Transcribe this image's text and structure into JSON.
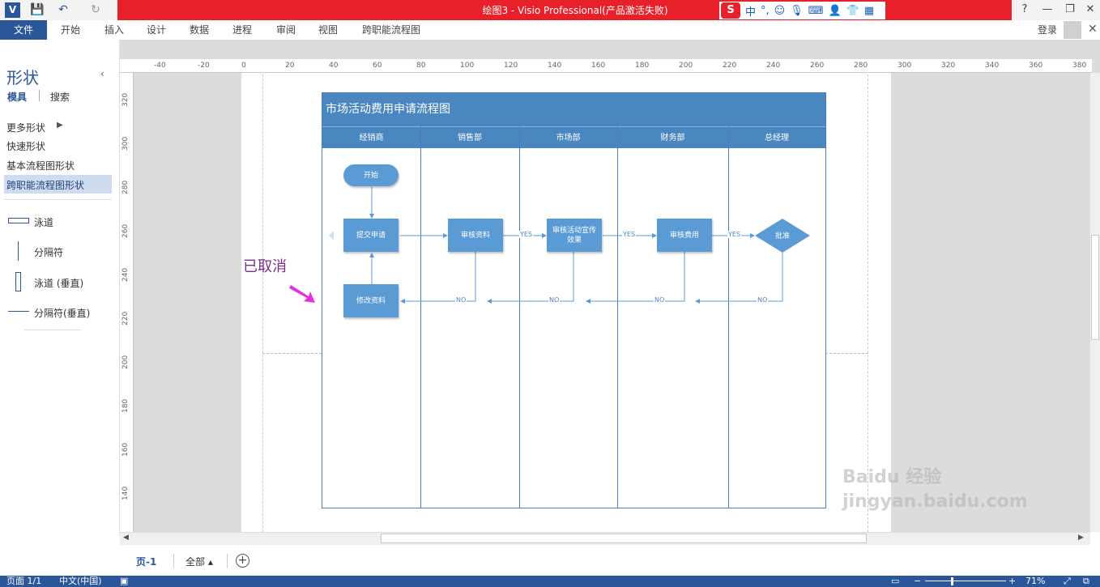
{
  "window": {
    "title": "绘图3 - Visio Professional(产品激活失败)",
    "help": "?",
    "minimize": "—",
    "restore": "❐",
    "close": "✕"
  },
  "ime": {
    "logo": "S",
    "mode": "中",
    "punct": "°,"
  },
  "ribbon": {
    "file": "文件",
    "tabs": [
      "开始",
      "插入",
      "设计",
      "数据",
      "进程",
      "审阅",
      "视图",
      "跨职能流程图"
    ],
    "login": "登录"
  },
  "shapes_panel": {
    "title": "形状",
    "tab_stencils": "模具",
    "tab_search": "搜索",
    "links": [
      "更多形状",
      "快速形状",
      "基本流程图形状",
      "跨职能流程图形状"
    ],
    "items": [
      "泳道",
      "分隔符",
      "泳道 (垂直)",
      "分隔符(垂直)"
    ]
  },
  "ruler": {
    "top": [
      "-40",
      "-20",
      "0",
      "20",
      "40",
      "60",
      "80",
      "100",
      "120",
      "140",
      "160",
      "180",
      "200",
      "220",
      "240",
      "260",
      "280",
      "300",
      "320",
      "340",
      "360",
      "380"
    ],
    "left": [
      "320",
      "300",
      "280",
      "260",
      "240",
      "220",
      "200",
      "180",
      "160",
      "140"
    ]
  },
  "diagram": {
    "title": "市场活动费用申请流程图",
    "lanes": [
      "经销商",
      "销售部",
      "市场部",
      "财务部",
      "总经理"
    ],
    "start": "开始",
    "submit": "提交申请",
    "review_docs": "审核资料",
    "review_campaign": "审核活动宣传效果",
    "review_cost": "审核费用",
    "approve": "批准",
    "modify": "修改资料",
    "yes": "YES",
    "no": "NO"
  },
  "annotation": "已取消",
  "pages": {
    "current": "页-1",
    "all": "全部 ▴",
    "add": "+"
  },
  "status": {
    "page": "页面 1/1",
    "language": "中文(中国)",
    "zoom": "71%"
  },
  "watermark": "Baidu 经验  jingyan.baidu.com"
}
